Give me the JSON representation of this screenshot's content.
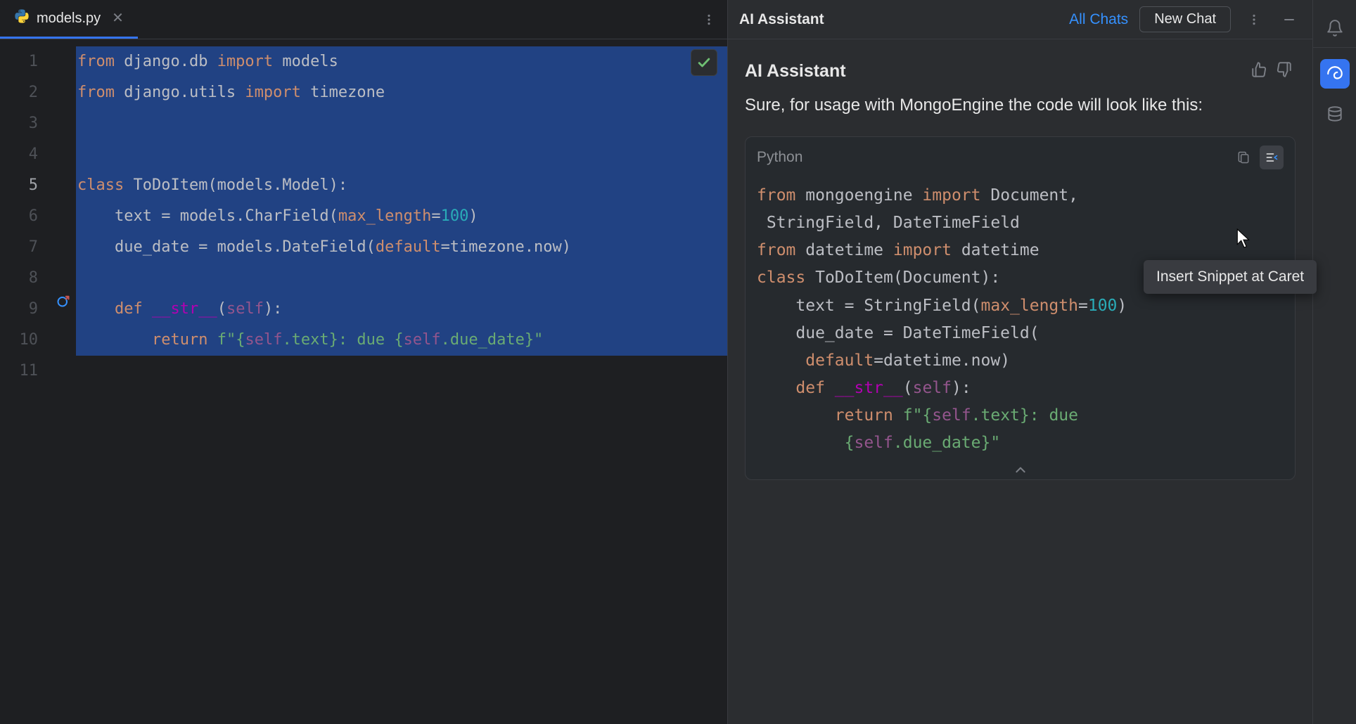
{
  "tab": {
    "filename": "models.py"
  },
  "editor": {
    "gutter_lines": [
      "1",
      "2",
      "3",
      "4",
      "5",
      "6",
      "7",
      "8",
      "9",
      "10",
      "11"
    ],
    "current_line_index": 4,
    "override_marker_line_index": 8,
    "code_lines": [
      {
        "sel": true,
        "tokens": [
          [
            "kw",
            "from"
          ],
          [
            "id",
            " django.db "
          ],
          [
            "kw",
            "import"
          ],
          [
            "id",
            " models"
          ]
        ]
      },
      {
        "sel": true,
        "tokens": [
          [
            "kw",
            "from"
          ],
          [
            "id",
            " django.utils "
          ],
          [
            "kw",
            "import"
          ],
          [
            "id",
            " timezone"
          ]
        ]
      },
      {
        "sel": true,
        "tokens": [
          [
            "id",
            ""
          ]
        ]
      },
      {
        "sel": true,
        "tokens": [
          [
            "id",
            ""
          ]
        ]
      },
      {
        "sel": true,
        "tokens": [
          [
            "kw",
            "class"
          ],
          [
            "id",
            " ToDoItem(models.Model):"
          ]
        ]
      },
      {
        "sel": true,
        "tokens": [
          [
            "id",
            "    text = models.CharField("
          ],
          [
            "param",
            "max_length"
          ],
          [
            "id",
            "="
          ],
          [
            "num",
            "100"
          ],
          [
            "id",
            ")"
          ]
        ]
      },
      {
        "sel": true,
        "tokens": [
          [
            "id",
            "    due_date = models.DateField("
          ],
          [
            "param",
            "default"
          ],
          [
            "id",
            "=timezone.now)"
          ]
        ]
      },
      {
        "sel": true,
        "tokens": [
          [
            "id",
            ""
          ]
        ]
      },
      {
        "sel": true,
        "tokens": [
          [
            "id",
            "    "
          ],
          [
            "kw",
            "def"
          ],
          [
            "id",
            " "
          ],
          [
            "dunder",
            "__str__"
          ],
          [
            "id",
            "("
          ],
          [
            "self",
            "self"
          ],
          [
            "id",
            "):"
          ]
        ]
      },
      {
        "sel": true,
        "tokens": [
          [
            "id",
            "        "
          ],
          [
            "kw",
            "return"
          ],
          [
            "id",
            " "
          ],
          [
            "str",
            "f\"{"
          ],
          [
            "self",
            "self"
          ],
          [
            "str",
            ".text}: due {"
          ],
          [
            "self",
            "self"
          ],
          [
            "str",
            ".due_date}\""
          ]
        ]
      },
      {
        "sel": false,
        "tokens": [
          [
            "id",
            ""
          ]
        ]
      }
    ]
  },
  "ai": {
    "panel_title": "AI Assistant",
    "all_chats": "All Chats",
    "new_chat": "New Chat",
    "msg_author": "AI Assistant",
    "msg_text": "Sure, for usage with MongoEngine the code will look like this:",
    "code_lang": "Python",
    "code_lines": [
      [
        [
          "kw",
          "from"
        ],
        [
          "id",
          " mongoengine "
        ],
        [
          "kw",
          "import"
        ],
        [
          "id",
          " Document,"
        ]
      ],
      [
        [
          "id",
          " StringField, DateTimeField"
        ]
      ],
      [
        [
          "kw",
          "from"
        ],
        [
          "id",
          " datetime "
        ],
        [
          "kw",
          "import"
        ],
        [
          "id",
          " datetime"
        ]
      ],
      [
        [
          "id",
          ""
        ]
      ],
      [
        [
          "id",
          ""
        ]
      ],
      [
        [
          "kw",
          "class"
        ],
        [
          "id",
          " ToDoItem(Document):"
        ]
      ],
      [
        [
          "id",
          "    text = StringField("
        ],
        [
          "param",
          "max_length"
        ],
        [
          "id",
          "="
        ],
        [
          "num",
          "100"
        ],
        [
          "id",
          ")"
        ]
      ],
      [
        [
          "id",
          "    due_date = DateTimeField("
        ]
      ],
      [
        [
          "id",
          "     "
        ],
        [
          "param",
          "default"
        ],
        [
          "id",
          "=datetime.now)"
        ]
      ],
      [
        [
          "id",
          ""
        ]
      ],
      [
        [
          "id",
          "    "
        ],
        [
          "kw",
          "def"
        ],
        [
          "id",
          " "
        ],
        [
          "dunder",
          "__str__"
        ],
        [
          "id",
          "("
        ],
        [
          "self",
          "self"
        ],
        [
          "id",
          "):"
        ]
      ],
      [
        [
          "id",
          "        "
        ],
        [
          "kw",
          "return"
        ],
        [
          "id",
          " "
        ],
        [
          "str",
          "f\"{"
        ],
        [
          "self",
          "self"
        ],
        [
          "str",
          ".text}: due"
        ]
      ],
      [
        [
          "id",
          "         "
        ],
        [
          "str",
          "{"
        ],
        [
          "self",
          "self"
        ],
        [
          "str",
          ".due_date}\""
        ]
      ]
    ]
  },
  "tooltip": {
    "text": "Insert Snippet at Caret"
  }
}
